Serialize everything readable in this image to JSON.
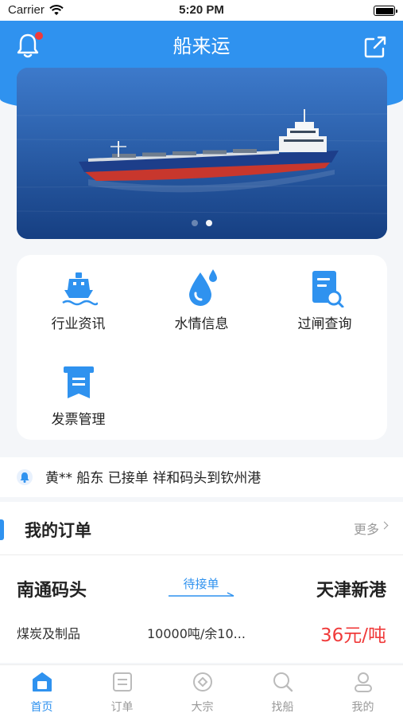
{
  "status_bar": {
    "carrier": "Carrier",
    "time": "5:20 PM"
  },
  "header": {
    "title": "船来运"
  },
  "banner": {
    "slides": 2,
    "active_index": 1
  },
  "menu": [
    {
      "label": "行业资讯",
      "icon": "ship-icon"
    },
    {
      "label": "水情信息",
      "icon": "water-drop-icon"
    },
    {
      "label": "过闸查询",
      "icon": "document-search-icon"
    },
    {
      "label": "发票管理",
      "icon": "invoice-icon"
    }
  ],
  "notice": {
    "text": "黄** 船东 已接单 祥和码头到钦州港"
  },
  "orders": {
    "title": "我的订单",
    "more": "更多",
    "order": {
      "from": "南通码头",
      "status": "待接单",
      "to": "天津新港",
      "cargo": "煤炭及制品",
      "quantity": "10000吨/余10...",
      "price": "36元/吨"
    }
  },
  "tabs": [
    {
      "label": "首页",
      "icon": "home-icon",
      "active": true
    },
    {
      "label": "订单",
      "icon": "order-list-icon",
      "active": false
    },
    {
      "label": "大宗",
      "icon": "bulk-icon",
      "active": false
    },
    {
      "label": "找船",
      "icon": "find-ship-icon",
      "active": false
    },
    {
      "label": "我的",
      "icon": "profile-icon",
      "active": false
    }
  ],
  "colors": {
    "primary": "#2f92ef",
    "price": "#f03a3a",
    "notice_dot": "#f03a3a"
  }
}
